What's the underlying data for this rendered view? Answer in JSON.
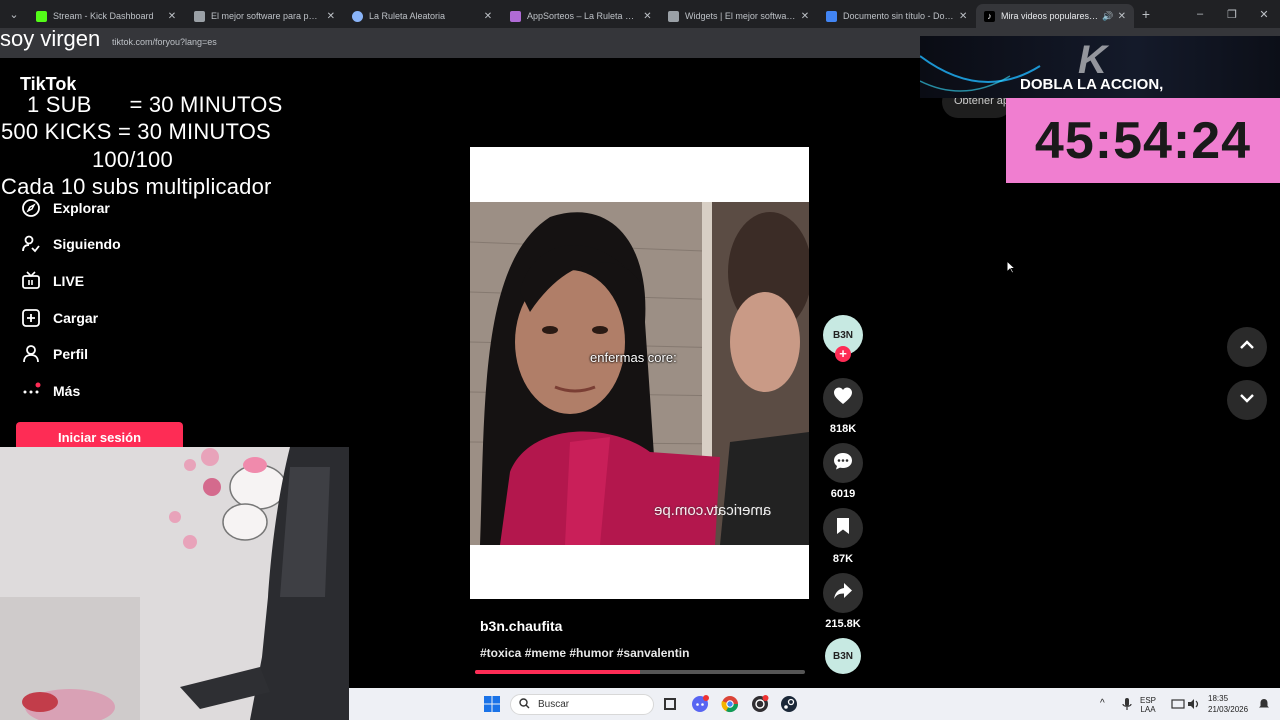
{
  "browser": {
    "tabs": [
      {
        "title": "Stream - Kick Dashboard",
        "favicon_color": "#53fc18",
        "active": false
      },
      {
        "title": "El mejor software para potenciar",
        "favicon_color": "#9aa0a6",
        "active": false
      },
      {
        "title": "La Ruleta Aleatoria",
        "favicon_color": "#8ab4f8",
        "active": false
      },
      {
        "title": "AppSorteos – La Ruleta de la Suerte",
        "favicon_color": "#b06bd6",
        "active": false
      },
      {
        "title": "Widgets | El mejor software para",
        "favicon_color": "#9aa0a6",
        "active": false
      },
      {
        "title": "Documento sin título - Documentos",
        "favicon_color": "#4285f4",
        "active": false
      },
      {
        "title": "Mira videos populares seleccionados",
        "favicon_color": "#ffffff",
        "active": true
      }
    ],
    "url": "tiktok.com/foryou?lang=es",
    "new_tab_symbol": "+",
    "window_controls": {
      "minimize": "–",
      "maximize": "❐",
      "close": "✕"
    }
  },
  "overlay": {
    "top_text": "soy virgen",
    "lines": [
      "1 SUB      = 30 MINUTOS",
      "500 KICKS = 30 MINUTOS",
      "100/100",
      "Cada 10 subs multiplicador"
    ]
  },
  "tiktok": {
    "logo": "TikTok",
    "nav": [
      {
        "label": "Explorar",
        "icon": "compass-icon"
      },
      {
        "label": "Siguiendo",
        "icon": "user-follow-icon"
      },
      {
        "label": "LIVE",
        "icon": "live-tv-icon"
      },
      {
        "label": "Cargar",
        "icon": "upload-plus-icon"
      },
      {
        "label": "Perfil",
        "icon": "person-icon"
      },
      {
        "label": "Más",
        "icon": "more-dots-icon"
      }
    ],
    "login_label": "Iniciar sesión",
    "video": {
      "caption_overlay": "enfermas core:",
      "watermark": "americatv.com.pe",
      "author": "b3n.chaufita",
      "hashtags": "#toxica #meme #humor #sanvalentin",
      "progress_fraction": 0.5
    },
    "actions": {
      "avatar_text": "B3N",
      "follow_symbol": "+",
      "likes": "818K",
      "comments": "6019",
      "saves": "87K",
      "shares": "215.8K"
    },
    "partial_button": "Obtener app"
  },
  "stream_widget": {
    "banner_text": "DOBLA LA ACCION,",
    "logo": "K",
    "timer": "45:54:24",
    "timer_bg": "#f07ed0"
  },
  "taskbar": {
    "search_label": "Buscar",
    "language": "ESP\nLAA",
    "time": "18:35",
    "date": "21/03/2026",
    "tray_up": "^"
  }
}
